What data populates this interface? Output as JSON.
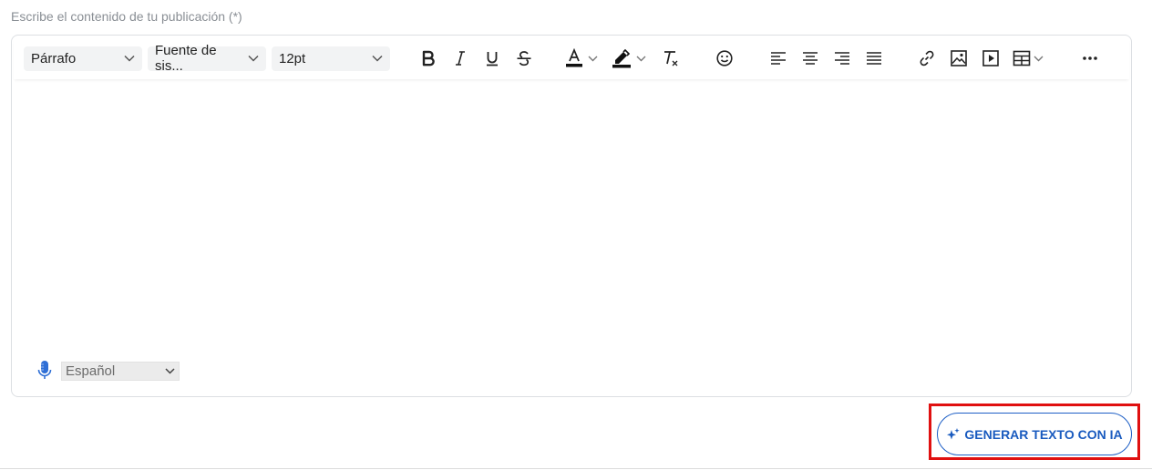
{
  "form": {
    "label": "Escribe el contenido de tu publicación (*)"
  },
  "toolbar": {
    "block_format": "Párrafo",
    "font_family": "Fuente de sis...",
    "font_size": "12pt"
  },
  "voice": {
    "language": "Español"
  },
  "ai_button": {
    "label": "GENERAR TEXTO CON IA"
  },
  "colors": {
    "accent": "#1a5bbf",
    "highlight": "#e01010",
    "border": "#dcdfe3"
  }
}
